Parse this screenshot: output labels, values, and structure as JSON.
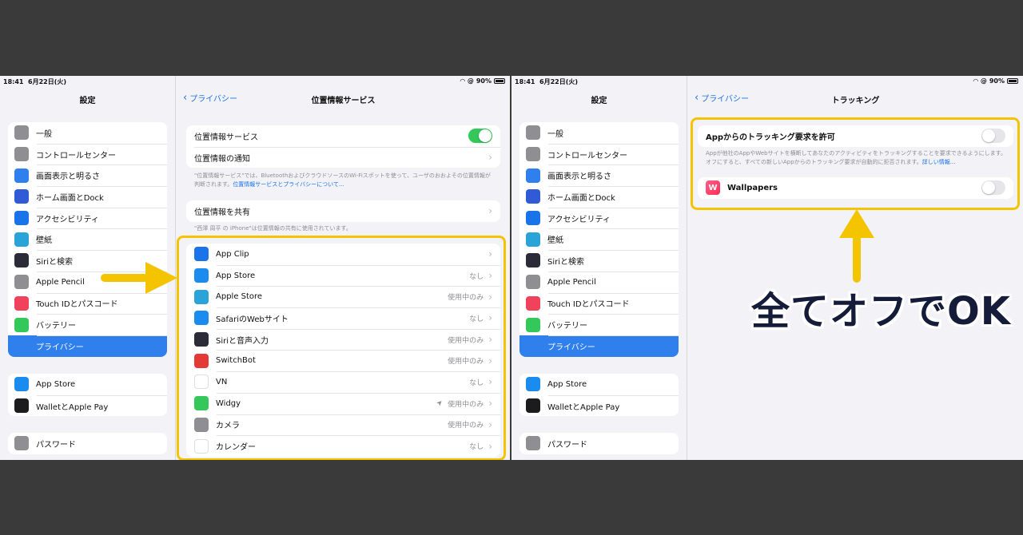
{
  "colors": {
    "accent": "#2f80ed",
    "highlight": "#f5c400",
    "toggle_on": "#34c759",
    "caption": "#141c3a"
  },
  "status": {
    "time": "18:41",
    "date": "6月22日(火)",
    "battery": "90%"
  },
  "sidebar": {
    "title": "設定",
    "group1": [
      {
        "label": "一般",
        "icon": "gear-icon",
        "color": "#8e8e93"
      },
      {
        "label": "コントロールセンター",
        "icon": "toggles-icon",
        "color": "#8e8e93"
      },
      {
        "label": "画面表示と明るさ",
        "icon": "text-size-icon",
        "color": "#2f80ed"
      },
      {
        "label": "ホーム画面とDock",
        "icon": "grid-icon",
        "color": "#2f5cd6"
      },
      {
        "label": "アクセシビリティ",
        "icon": "accessibility-icon",
        "color": "#1a73e8"
      },
      {
        "label": "壁紙",
        "icon": "flower-icon",
        "color": "#29a3d8"
      },
      {
        "label": "Siriと検索",
        "icon": "siri-icon",
        "color": "#2b2b3a"
      },
      {
        "label": "Apple Pencil",
        "icon": "pencil-icon",
        "color": "#8e8e93"
      },
      {
        "label": "Touch IDとパスコード",
        "icon": "fingerprint-icon",
        "color": "#f0435b"
      },
      {
        "label": "バッテリー",
        "icon": "battery-icon",
        "color": "#34c759"
      },
      {
        "label": "プライバシー",
        "icon": "hand-icon",
        "color": "#2f80ed",
        "active": true
      }
    ],
    "group2": [
      {
        "label": "App Store",
        "icon": "appstore-icon",
        "color": "#1a8cf0"
      },
      {
        "label": "WalletとApple Pay",
        "icon": "wallet-icon",
        "color": "#1c1c1e"
      }
    ],
    "group3": [
      {
        "label": "パスワード",
        "icon": "key-icon",
        "color": "#8e8e93"
      }
    ]
  },
  "location": {
    "back": "プライバシー",
    "title": "位置情報サービス",
    "service_label": "位置情報サービス",
    "alert_label": "位置情報の通知",
    "note": "\"位置情報サービス\"では、BluetoothおよびクラウドソースのWi-Fiスポットを使って、ユーザのおおよその位置情報が判断されます。",
    "note_link": "位置情報サービスとプライバシーについて...",
    "share_label": "位置情報を共有",
    "share_note": "\"西澤 周平 の iPhone\"は位置情報の共有に使用されています。",
    "apps": [
      {
        "name": "App Clip",
        "status": "",
        "icon": "appclip-icon",
        "color": "#1a73e8"
      },
      {
        "name": "App Store",
        "status": "なし",
        "icon": "appstore-icon",
        "color": "#1a8cf0"
      },
      {
        "name": "Apple Store",
        "status": "使用中のみ",
        "icon": "bag-icon",
        "color": "#29a3d8"
      },
      {
        "name": "SafariのWebサイト",
        "status": "なし",
        "icon": "compass-icon",
        "color": "#1a8cf0"
      },
      {
        "name": "Siriと音声入力",
        "status": "使用中のみ",
        "icon": "siri-icon",
        "color": "#2b2b3a"
      },
      {
        "name": "SwitchBot",
        "status": "使用中のみ",
        "icon": "switchbot-icon",
        "color": "#e53935"
      },
      {
        "name": "VN",
        "status": "なし",
        "icon": "vn-icon",
        "color": "#ffffff"
      },
      {
        "name": "Widgy",
        "status": "使用中のみ",
        "icon": "widgy-icon",
        "color": "#34c759",
        "arrow": true
      },
      {
        "name": "カメラ",
        "status": "使用中のみ",
        "icon": "camera-icon",
        "color": "#8e8e93"
      },
      {
        "name": "カレンダー",
        "status": "なし",
        "icon": "calendar-icon",
        "color": "#ffffff"
      }
    ]
  },
  "tracking": {
    "back": "プライバシー",
    "title": "トラッキング",
    "allow_label": "Appからのトラッキング要求を許可",
    "note": "Appが他社のAppやWebサイトを横断してあなたのアクティビティをトラッキングすることを要求できるようにします。オフにすると、すべての新しいAppからのトラッキング要求が自動的に拒否されます。",
    "note_link": "詳しい情報...",
    "app_label": "Wallpapers"
  },
  "caption": "全てオフでOK"
}
